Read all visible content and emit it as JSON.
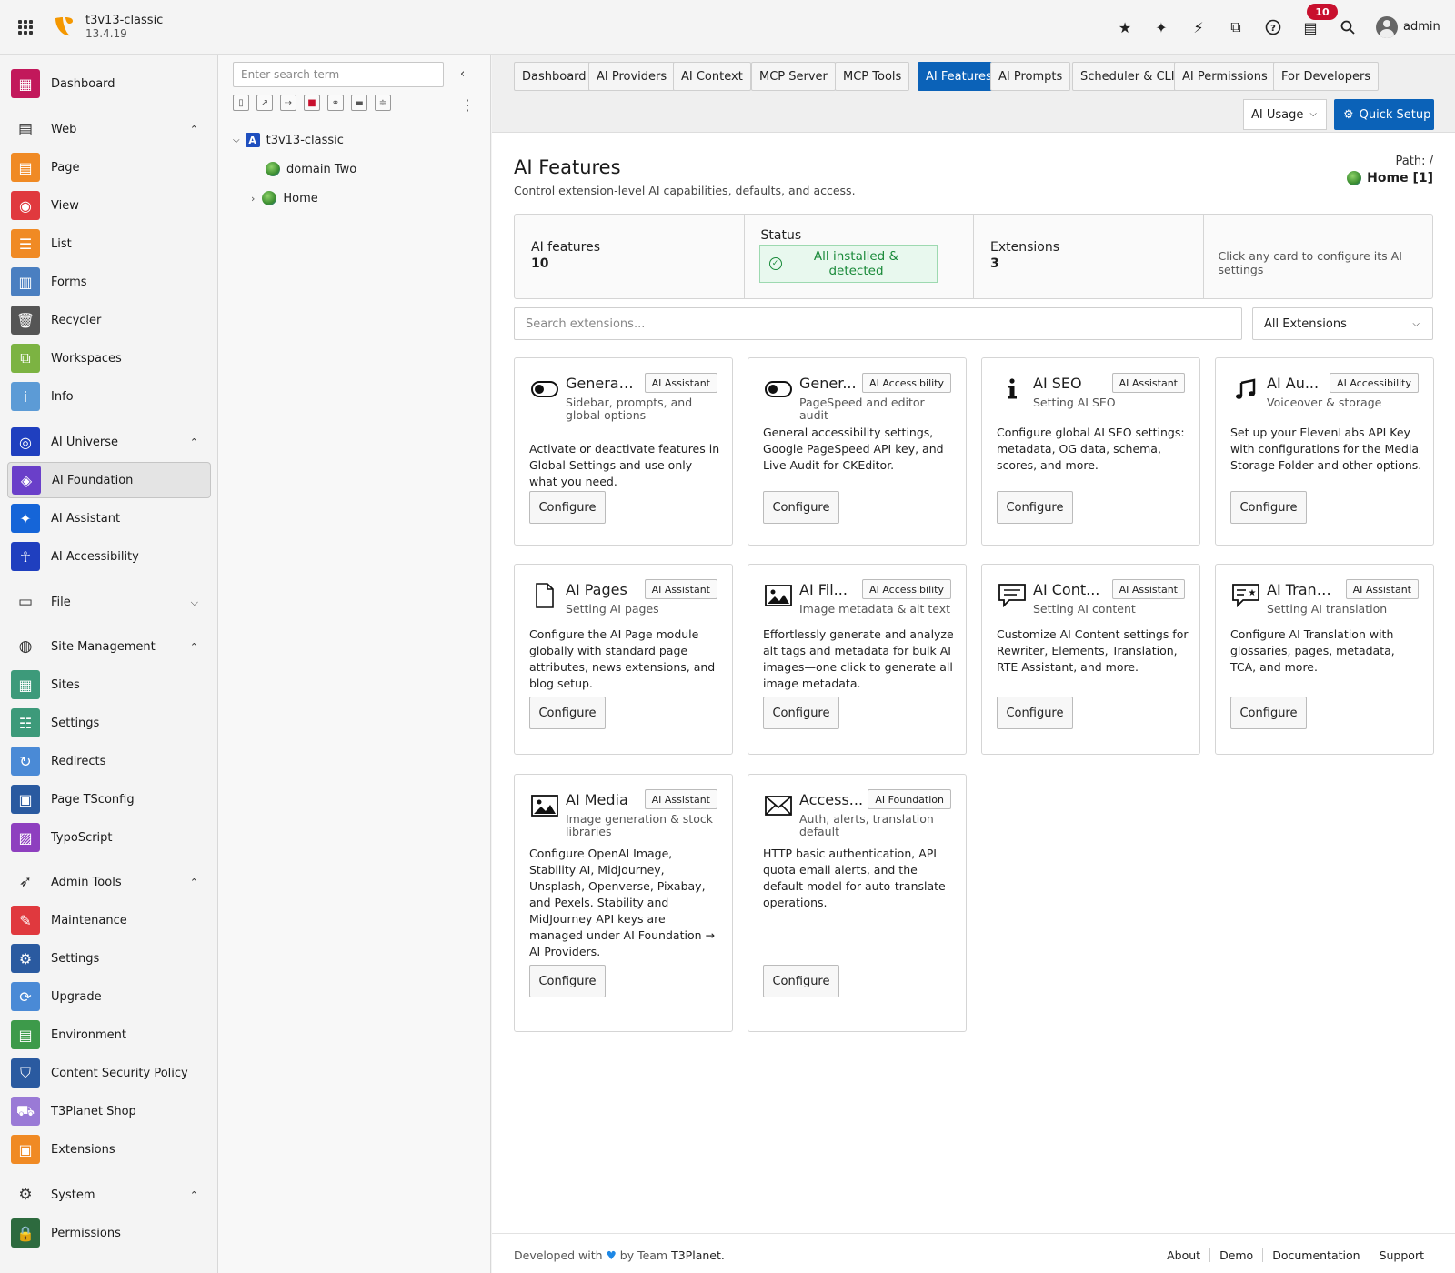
{
  "topbar": {
    "site_name": "t3v13-classic",
    "version": "13.4.19",
    "notifications": "10",
    "user": "admin"
  },
  "sidebar": {
    "items": [
      {
        "label": "Dashboard",
        "color": "#c2185b",
        "icon": "dashboard-icon"
      },
      {
        "label": "Web",
        "group": true,
        "icon": "page-icon"
      },
      {
        "label": "Page",
        "color": "#f08a24",
        "icon": "page-icon"
      },
      {
        "label": "View",
        "color": "#e0393e",
        "icon": "eye-icon"
      },
      {
        "label": "List",
        "color": "#f08a24",
        "icon": "list-icon"
      },
      {
        "label": "Forms",
        "color": "#4a7fc1",
        "icon": "forms-icon"
      },
      {
        "label": "Recycler",
        "color": "#555555",
        "icon": "trash-icon"
      },
      {
        "label": "Workspaces",
        "color": "#7cb342",
        "icon": "workspaces-icon"
      },
      {
        "label": "Info",
        "color": "#5c9bd6",
        "icon": "info-icon"
      },
      {
        "label": "AI Universe",
        "color": "#1f3fbf",
        "icon": "ai-universe-icon"
      },
      {
        "label": "AI Foundation",
        "color": "#6a3fc9",
        "icon": "layers-icon"
      },
      {
        "label": "AI Assistant",
        "color": "#1565d8",
        "icon": "sparkle-icon"
      },
      {
        "label": "AI Accessibility",
        "color": "#1f3fbf",
        "icon": "accessibility-icon"
      },
      {
        "label": "File",
        "group": true,
        "icon": "folder-icon"
      },
      {
        "label": "Site Management",
        "group": true,
        "icon": "globe-icon"
      },
      {
        "label": "Sites",
        "color": "#3d9a7a",
        "icon": "sites-icon"
      },
      {
        "label": "Settings",
        "color": "#3d9a7a",
        "icon": "settings-icon"
      },
      {
        "label": "Redirects",
        "color": "#4a8ad6",
        "icon": "redirect-icon"
      },
      {
        "label": "Page TSconfig",
        "color": "#2a5aa0",
        "icon": "tsconfig-icon"
      },
      {
        "label": "TypoScript",
        "color": "#8e3fbf",
        "icon": "typoscript-icon"
      },
      {
        "label": "Admin Tools",
        "group": true,
        "icon": "rocket-icon"
      },
      {
        "label": "Maintenance",
        "color": "#e0393e",
        "icon": "wrench-icon"
      },
      {
        "label": "Settings",
        "color": "#2a5aa0",
        "icon": "gear-icon"
      },
      {
        "label": "Upgrade",
        "color": "#4a8ad6",
        "icon": "upgrade-icon"
      },
      {
        "label": "Environment",
        "color": "#3d9a4a",
        "icon": "environment-icon"
      },
      {
        "label": "Content Security Policy",
        "color": "#2a5aa0",
        "icon": "shield-icon"
      },
      {
        "label": "T3Planet Shop",
        "color": "#9a7ad6",
        "icon": "cart-icon"
      },
      {
        "label": "Extensions",
        "color": "#f08a24",
        "icon": "box-icon"
      },
      {
        "label": "System",
        "group": true,
        "icon": "gear-icon"
      },
      {
        "label": "Permissions",
        "color": "#2d6a3e",
        "icon": "lock-icon"
      }
    ]
  },
  "tree": {
    "search_placeholder": "Enter search term",
    "root": "t3v13-classic",
    "children": [
      "domain Two",
      "Home"
    ]
  },
  "tabs": [
    "Dashboard",
    "AI Providers",
    "AI Context",
    "MCP Server",
    "MCP Tools",
    "AI Features",
    "AI Prompts",
    "Scheduler & CLI",
    "AI Permissions",
    "For Developers"
  ],
  "active_tab": "AI Features",
  "toolbar": {
    "usage_label": "AI Usage",
    "quick_setup": "Quick Setup"
  },
  "header": {
    "title": "AI Features",
    "subtitle": "Control extension-level AI capabilities, defaults, and access.",
    "path_label": "Path: /",
    "path_value": "Home [1]"
  },
  "stats": {
    "features_label": "AI features",
    "features_value": "10",
    "status_label": "Status",
    "status_value": "All installed & detected",
    "extensions_label": "Extensions",
    "extensions_value": "3",
    "hint": "Click any card to configure its AI settings"
  },
  "filter": {
    "search_placeholder": "Search extensions...",
    "select_value": "All Extensions"
  },
  "cards": [
    {
      "title": "General ...",
      "badge": "AI Assistant",
      "sub": "Sidebar, prompts, and global options",
      "desc": "Activate or deactivate features in Global Settings and use only what you need.",
      "button": "Configure",
      "icon": "toggle-icon"
    },
    {
      "title": "Gener...",
      "badge": "AI Accessibility",
      "sub": "PageSpeed and editor audit",
      "desc": "General accessibility settings, Google PageSpeed API key, and Live Audit for CKEditor.",
      "button": "Configure",
      "icon": "toggle-icon"
    },
    {
      "title": "AI SEO",
      "badge": "AI Assistant",
      "sub": "Setting AI SEO",
      "desc": "Configure global AI SEO settings: metadata, OG data, schema, scores, and more.",
      "button": "Configure",
      "icon": "info-icon"
    },
    {
      "title": "AI Au...",
      "badge": "AI Accessibility",
      "sub": "Voiceover & storage",
      "desc": "Set up your ElevenLabs API Key with configurations for the Media Storage Folder and other options.",
      "button": "Configure",
      "icon": "music-icon"
    },
    {
      "title": "AI Pages",
      "badge": "AI Assistant",
      "sub": "Setting AI pages",
      "desc": "Configure the AI Page module globally with standard page attributes, news extensions, and blog setup.",
      "button": "Configure",
      "icon": "file-icon"
    },
    {
      "title": "AI Fil...",
      "badge": "AI Accessibility",
      "sub": "Image metadata & alt text",
      "desc": "Effortlessly generate and analyze alt tags and metadata for bulk AI images—one click to generate all image metadata.",
      "button": "Configure",
      "icon": "image-icon"
    },
    {
      "title": "AI Cont...",
      "badge": "AI Assistant",
      "sub": "Setting AI content",
      "desc": "Customize AI Content settings for Rewriter, Elements, Translation, RTE Assistant, and more.",
      "button": "Configure",
      "icon": "comment-icon"
    },
    {
      "title": "AI Trans...",
      "badge": "AI Assistant",
      "sub": "Setting AI translation",
      "desc": "Configure AI Translation with glossaries, pages, metadata, TCA, and more.",
      "button": "Configure",
      "icon": "translate-icon"
    },
    {
      "title": "AI Media",
      "badge": "AI Assistant",
      "sub": "Image generation & stock libraries",
      "desc": "Configure OpenAI Image, Stability AI, MidJourney, Unsplash, Openverse, Pixabay, and Pexels. Stability and MidJourney API keys are managed under AI Foundation → AI Providers.",
      "button": "Configure",
      "icon": "image-icon"
    },
    {
      "title": "Access...",
      "badge": "AI Foundation",
      "sub": "Auth, alerts, translation default",
      "desc": "HTTP basic authentication, API quota email alerts, and the default model for auto-translate operations.",
      "button": "Configure",
      "icon": "envelope-icon"
    }
  ],
  "footer": {
    "dev_prefix": "Developed with",
    "dev_by": "by Team",
    "dev_team": "T3Planet.",
    "links": [
      "About",
      "Demo",
      "Documentation",
      "Support"
    ]
  }
}
